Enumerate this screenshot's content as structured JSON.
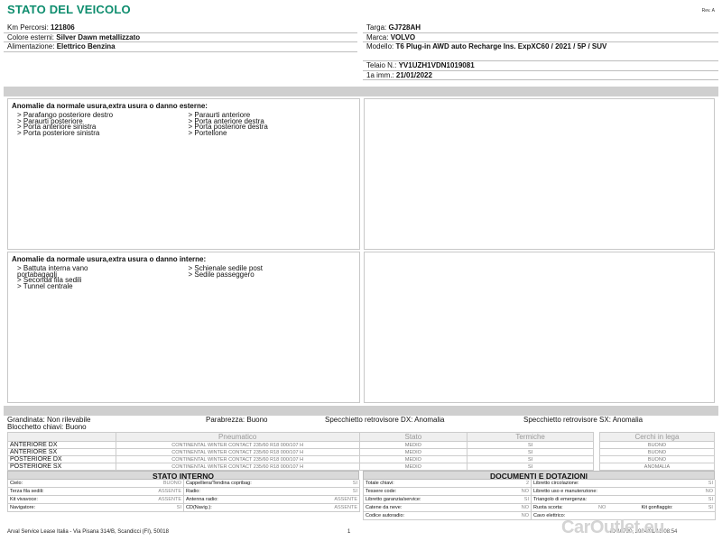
{
  "header": {
    "title": "STATO DEL VEICOLO",
    "rev": "Rev. A"
  },
  "vehicle_left": [
    {
      "label": "Km Percorsi:",
      "value": "121806"
    },
    {
      "label": "Colore esterni:",
      "value": "Silver Dawn metallizzato"
    },
    {
      "label": "Alimentazione:",
      "value": "Elettrico Benzina"
    }
  ],
  "vehicle_right": {
    "targa": {
      "label": "Targa:",
      "value": "GJ728AH"
    },
    "marca": {
      "label": "Marca:",
      "value": "VOLVO"
    },
    "modello": {
      "label": "Modello:",
      "value": "T6 Plug-in AWD auto Recharge Ins. ExpXC60 / 2021 / 5P / SUV"
    },
    "telaio": {
      "label": "Telaio N.:",
      "value": "YV1UZH1VDN1019081"
    },
    "imm": {
      "label": "1a imm.:",
      "value": "21/01/2022"
    }
  },
  "exterior": {
    "heading": "Anomalie da normale usura,extra usura o danno esterne:",
    "col1": [
      "> Parafango posteriore destro",
      "> Paraurti posteriore",
      "> Porta anteriore sinistra",
      "> Porta posteriore sinistra"
    ],
    "col2": [
      "> Paraurti anteriore",
      "> Porta anteriore destra",
      "> Porta posteriore destra",
      "> Portellone"
    ]
  },
  "interior": {
    "heading": "Anomalie da normale usura,extra usura o danno interne:",
    "col1": [
      "> Battuta interna vano",
      "portabagagli",
      "> Seconda fila sedili",
      "> Tunnel centrale"
    ],
    "col2": [
      "> Schienale sedile post",
      "> Sedile passeggero"
    ]
  },
  "summary": {
    "grandinata": "Grandinata: Non rilevabile",
    "blocchetto": "Blocchetto chiavi: Buono",
    "parabrezza": "Parabrezza: Buono",
    "specchietto_dx": "Specchietto retrovisore DX: Anomalia",
    "specchietto_sx": "Specchietto retrovisore SX: Anomalia"
  },
  "tyres": {
    "headers": [
      "",
      "Pneumatico",
      "Stato",
      "Termiche"
    ],
    "rows": [
      {
        "pos": "ANTERIORE DX",
        "tyre": "CONTINENTAL WINTER CONTACT  235/60 R18 000/107 H",
        "stato": "MEDIO",
        "termiche": "SI"
      },
      {
        "pos": "ANTERIORE SX",
        "tyre": "CONTINENTAL WINTER CONTACT  235/60 R18 000/107 H",
        "stato": "MEDIO",
        "termiche": "SI"
      },
      {
        "pos": "POSTERIORE DX",
        "tyre": "CONTINENTAL WINTER CONTACT  235/60 R18 000/107 H",
        "stato": "MEDIO",
        "termiche": "SI"
      },
      {
        "pos": "POSTERIORE SX",
        "tyre": "CONTINENTAL WINTER CONTACT  235/60 R18 000/107 H",
        "stato": "MEDIO",
        "termiche": "SI"
      }
    ]
  },
  "rims": {
    "header": "Cerchi in lega",
    "rows": [
      "BUONO",
      "BUONO",
      "BUONO",
      "ANOMALIA"
    ]
  },
  "stato_interno": {
    "title": "STATO INTERNO",
    "cells": [
      {
        "l": "Cielo:",
        "r": "BUONO"
      },
      {
        "l": "Cappelliera/Tendina copribag:",
        "r": "SI"
      },
      {
        "l": "Terza fila sedili:",
        "r": "ASSENTE"
      },
      {
        "l": "Radio:",
        "r": "SI"
      },
      {
        "l": "Kit vivavoce:",
        "r": "ASSENTE"
      },
      {
        "l": "Antenna radio:",
        "r": "ASSENTE"
      },
      {
        "l": "Navigatore:",
        "r": "SI"
      },
      {
        "l": "CD(Navig.):",
        "r": "ASSENTE"
      }
    ]
  },
  "documenti": {
    "title": "DOCUMENTI E DOTAZIONI",
    "cells": [
      {
        "l": "Totale chiavi:",
        "r": "2"
      },
      {
        "l": "Libretto circolazione:",
        "r": "SI"
      },
      {
        "l": "Tessere code:",
        "r": "NO"
      },
      {
        "l": "Libretto uso e manutenzione:",
        "r": "NO"
      },
      {
        "l": "Libretto garanzia/service:",
        "r": "SI"
      },
      {
        "l": "Triangolo di emergenza:",
        "r": "SI"
      },
      {
        "l": "Catene da neve:",
        "r": "NO"
      },
      {
        "l": "Ruota scorta:",
        "r": "NO"
      },
      {
        "l": "Codice autoradio:",
        "r": "NO"
      },
      {
        "l": "Cavo elettrico:",
        "r": ""
      }
    ],
    "extra": {
      "l": "Kit gonfiaggio:",
      "r": "SI"
    }
  },
  "footer": {
    "address": "Arval Service Lease Italia - Via Pisana 314/B, Scandicci (FI), 50018",
    "page": "1",
    "doc_id": "ID 10790, 2024/01/18 08:54"
  },
  "watermark": "CarOutlet.eu"
}
